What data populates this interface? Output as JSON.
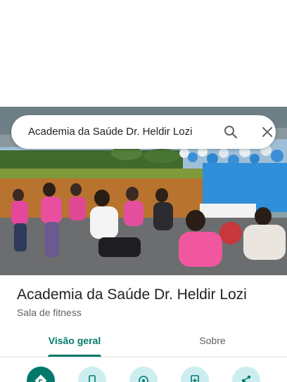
{
  "search": {
    "query": "Academia da Saúde Dr. Heldir Lozi"
  },
  "place": {
    "title": "Academia da Saúde Dr. Heldir Lozi",
    "category": "Sala de fitness"
  },
  "tabs": [
    {
      "label": "Visão geral",
      "selected": true
    },
    {
      "label": "Sobre",
      "selected": false
    }
  ],
  "actions": [
    {
      "icon": "directions-icon"
    },
    {
      "icon": "phone-icon"
    },
    {
      "icon": "save-icon"
    },
    {
      "icon": "add-photo-icon"
    },
    {
      "icon": "share-icon"
    }
  ],
  "colors": {
    "accent": "#00796b",
    "action_bg": "#cdeef0",
    "text_primary": "#202124",
    "text_secondary": "#5f6368"
  }
}
